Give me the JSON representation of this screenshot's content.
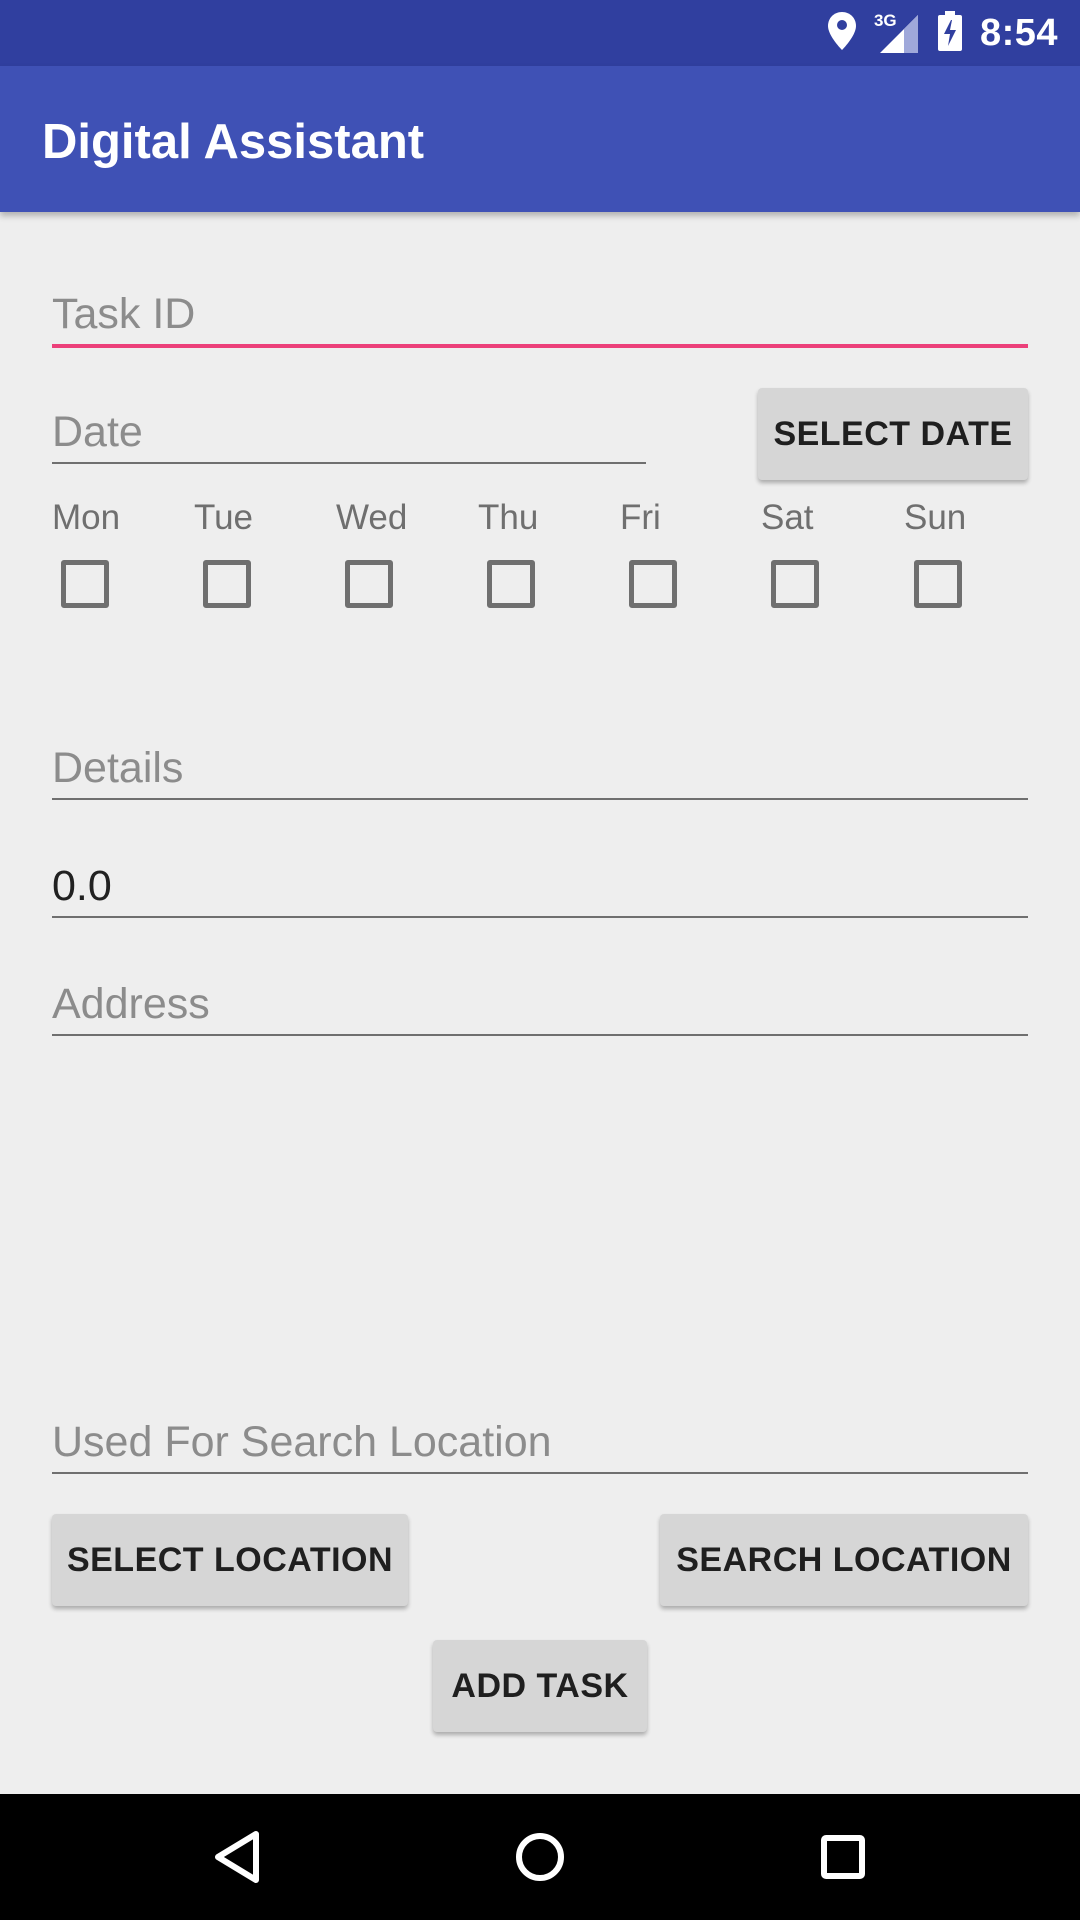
{
  "status_bar": {
    "time": "8:54",
    "network": "3G",
    "icons": [
      "location-icon",
      "signal-icon",
      "battery-charging-icon"
    ]
  },
  "app_bar": {
    "title": "Digital Assistant"
  },
  "form": {
    "task_id_placeholder": "Task ID",
    "date_placeholder": "Date",
    "select_date_label": "SELECT DATE",
    "days": [
      "Mon",
      "Tue",
      "Wed",
      "Thu",
      "Fri",
      "Sat",
      "Sun"
    ],
    "details_placeholder": "Details",
    "amount_value": "0.0",
    "address_placeholder": "Address",
    "search_location_placeholder": "Used For Search Location",
    "select_location_label": "SELECT LOCATION",
    "search_location_label": "SEARCH LOCATION",
    "add_task_label": "ADD TASK"
  },
  "colors": {
    "status_bar": "#303f9f",
    "app_bar": "#3f51b5",
    "accent": "#ec407a",
    "background": "#eeeeee"
  },
  "nav_bar": {
    "icons": [
      "back-icon",
      "home-icon",
      "recents-icon"
    ]
  }
}
